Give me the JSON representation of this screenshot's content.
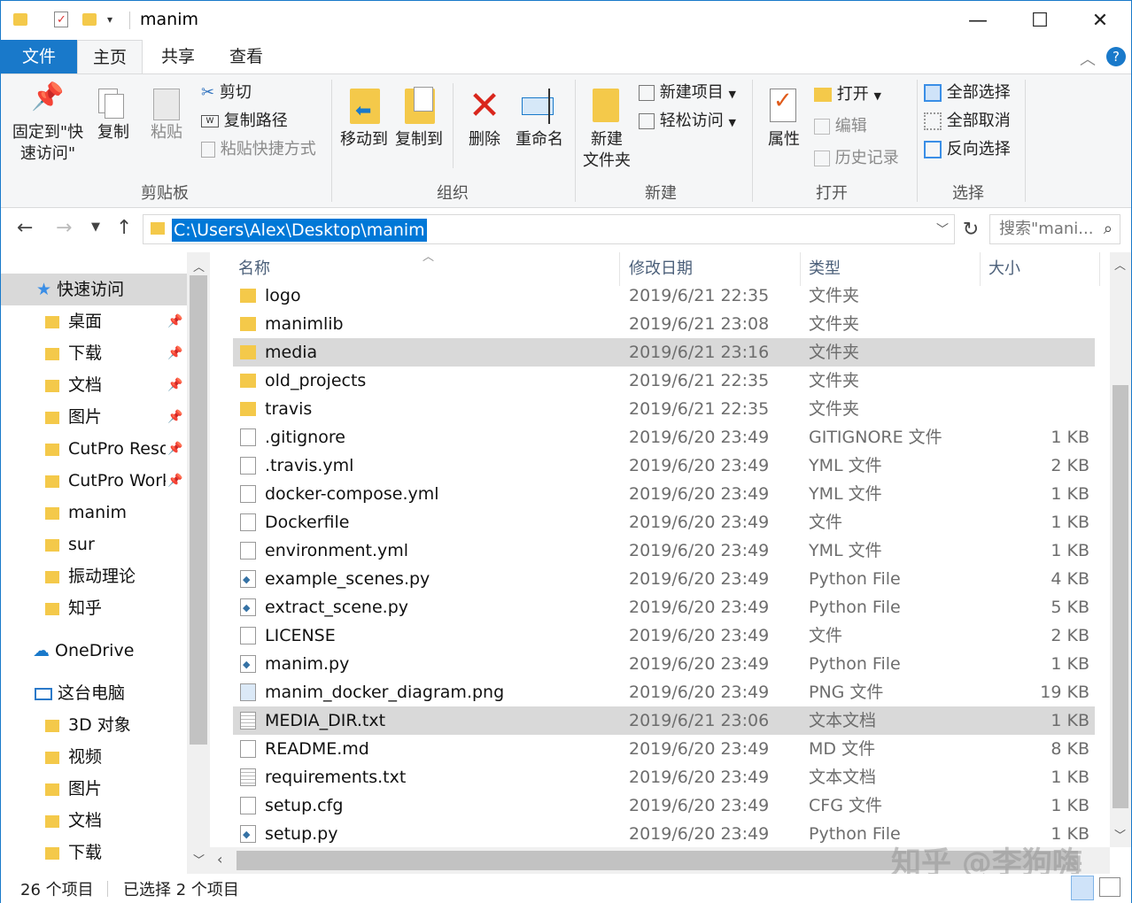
{
  "window": {
    "title": "manim",
    "minimize": "—",
    "maximize": "☐",
    "close": "✕"
  },
  "tabs": {
    "file": "文件",
    "home": "主页",
    "share": "共享",
    "view": "查看"
  },
  "ribbon": {
    "clipboard": {
      "label": "剪贴板",
      "pin_line1": "固定到\"快",
      "pin_line2": "速访问\"",
      "copy": "复制",
      "paste": "粘贴",
      "cut": "剪切",
      "copy_path": "复制路径",
      "paste_shortcut": "粘贴快捷方式"
    },
    "organize": {
      "label": "组织",
      "move_to": "移动到",
      "copy_to": "复制到",
      "delete": "删除",
      "rename": "重命名"
    },
    "new": {
      "label": "新建",
      "new_folder_line1": "新建",
      "new_folder_line2": "文件夹",
      "new_item": "新建项目",
      "easy_access": "轻松访问"
    },
    "open": {
      "label": "打开",
      "properties": "属性",
      "open": "打开",
      "edit": "编辑",
      "history": "历史记录"
    },
    "select": {
      "label": "选择",
      "select_all": "全部选择",
      "select_none": "全部取消",
      "invert": "反向选择"
    }
  },
  "address": {
    "path": "C:\\Users\\Alex\\Desktop\\manim",
    "search_placeholder": "搜索\"mani..."
  },
  "nav": {
    "quick_access": "快速访问",
    "items": [
      {
        "label": "桌面",
        "pinned": true
      },
      {
        "label": "下载",
        "pinned": true
      },
      {
        "label": "文档",
        "pinned": true
      },
      {
        "label": "图片",
        "pinned": true
      },
      {
        "label": "CutPro Reso",
        "pinned": true
      },
      {
        "label": "CutPro Work",
        "pinned": true
      },
      {
        "label": "manim",
        "pinned": false
      },
      {
        "label": "sur",
        "pinned": false
      },
      {
        "label": "振动理论",
        "pinned": false
      },
      {
        "label": "知乎",
        "pinned": false
      }
    ],
    "onedrive": "OneDrive",
    "this_pc": "这台电脑",
    "pc_items": [
      "3D 对象",
      "视频",
      "图片",
      "文档",
      "下载"
    ]
  },
  "columns": {
    "name": "名称",
    "date": "修改日期",
    "type": "类型",
    "size": "大小"
  },
  "files": [
    {
      "name": "logo",
      "date": "2019/6/21 22:35",
      "type": "文件夹",
      "size": "",
      "icon": "folder",
      "selected": false
    },
    {
      "name": "manimlib",
      "date": "2019/6/21 23:08",
      "type": "文件夹",
      "size": "",
      "icon": "folder",
      "selected": false
    },
    {
      "name": "media",
      "date": "2019/6/21 23:16",
      "type": "文件夹",
      "size": "",
      "icon": "folder",
      "selected": true
    },
    {
      "name": "old_projects",
      "date": "2019/6/21 22:35",
      "type": "文件夹",
      "size": "",
      "icon": "folder",
      "selected": false
    },
    {
      "name": "travis",
      "date": "2019/6/21 22:35",
      "type": "文件夹",
      "size": "",
      "icon": "folder",
      "selected": false
    },
    {
      "name": ".gitignore",
      "date": "2019/6/20 23:49",
      "type": "GITIGNORE 文件",
      "size": "1 KB",
      "icon": "file",
      "selected": false
    },
    {
      "name": ".travis.yml",
      "date": "2019/6/20 23:49",
      "type": "YML 文件",
      "size": "2 KB",
      "icon": "file",
      "selected": false
    },
    {
      "name": "docker-compose.yml",
      "date": "2019/6/20 23:49",
      "type": "YML 文件",
      "size": "1 KB",
      "icon": "file",
      "selected": false
    },
    {
      "name": "Dockerfile",
      "date": "2019/6/20 23:49",
      "type": "文件",
      "size": "1 KB",
      "icon": "file",
      "selected": false
    },
    {
      "name": "environment.yml",
      "date": "2019/6/20 23:49",
      "type": "YML 文件",
      "size": "1 KB",
      "icon": "file",
      "selected": false
    },
    {
      "name": "example_scenes.py",
      "date": "2019/6/20 23:49",
      "type": "Python File",
      "size": "4 KB",
      "icon": "python",
      "selected": false
    },
    {
      "name": "extract_scene.py",
      "date": "2019/6/20 23:49",
      "type": "Python File",
      "size": "5 KB",
      "icon": "python",
      "selected": false
    },
    {
      "name": "LICENSE",
      "date": "2019/6/20 23:49",
      "type": "文件",
      "size": "2 KB",
      "icon": "file",
      "selected": false
    },
    {
      "name": "manim.py",
      "date": "2019/6/20 23:49",
      "type": "Python File",
      "size": "1 KB",
      "icon": "python",
      "selected": false
    },
    {
      "name": "manim_docker_diagram.png",
      "date": "2019/6/20 23:49",
      "type": "PNG 文件",
      "size": "19 KB",
      "icon": "image",
      "selected": false
    },
    {
      "name": "MEDIA_DIR.txt",
      "date": "2019/6/21 23:06",
      "type": "文本文档",
      "size": "1 KB",
      "icon": "text",
      "selected": true
    },
    {
      "name": "README.md",
      "date": "2019/6/20 23:49",
      "type": "MD 文件",
      "size": "8 KB",
      "icon": "file",
      "selected": false
    },
    {
      "name": "requirements.txt",
      "date": "2019/6/20 23:49",
      "type": "文本文档",
      "size": "1 KB",
      "icon": "text",
      "selected": false
    },
    {
      "name": "setup.cfg",
      "date": "2019/6/20 23:49",
      "type": "CFG 文件",
      "size": "1 KB",
      "icon": "file",
      "selected": false
    },
    {
      "name": "setup.py",
      "date": "2019/6/20 23:49",
      "type": "Python File",
      "size": "1 KB",
      "icon": "python",
      "selected": false
    }
  ],
  "status": {
    "count": "26 个项目",
    "selected": "已选择 2 个项目"
  },
  "watermark": "知乎 @李狗嗨",
  "colors": {
    "accent": "#1979ca",
    "folder": "#f4c94a",
    "selection": "#d9d9d9",
    "address_selection": "#0078d7"
  }
}
